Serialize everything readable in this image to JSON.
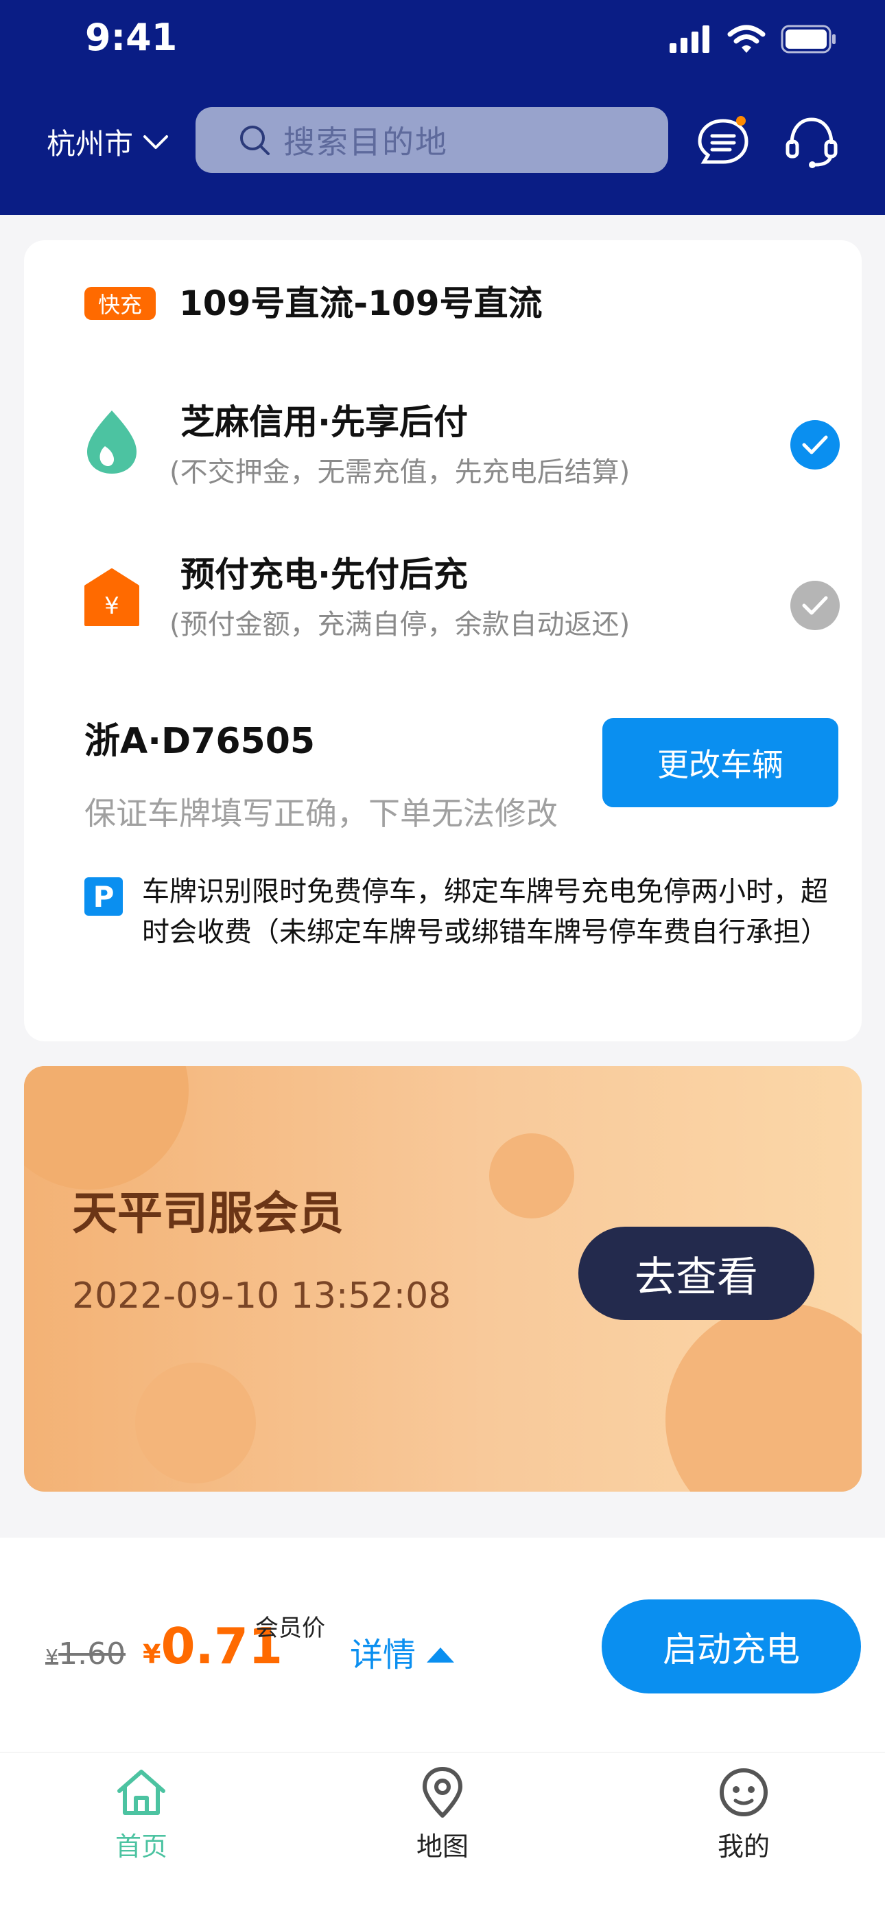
{
  "status_bar": {
    "time": "9:41"
  },
  "header": {
    "city": "杭州市",
    "search_placeholder": "搜索目的地",
    "icons": [
      "chevron-down-icon",
      "search-icon",
      "message-icon",
      "customer-service-icon"
    ],
    "colors": {
      "background": "#0a1d85",
      "notification_dot": "#ff8a00"
    }
  },
  "station": {
    "badge": "快充",
    "name": "109号直流-109号直流"
  },
  "payment_options": [
    {
      "title": "芝麻信用·先享后付",
      "desc": "(不交押金，无需充值，先充电后结算)",
      "selected": true,
      "icon": "sesame-credit-icon"
    },
    {
      "title": "预付充电·先付后充",
      "desc": "(预付金额，充满自停，余款自动返还)",
      "selected": false,
      "icon": "prepaid-yen-icon"
    }
  ],
  "vehicle": {
    "plate": "浙A·D76505",
    "hint": "保证车牌填写正确，下单无法修改",
    "change_button": "更改车辆"
  },
  "parking": {
    "icon_label": "P",
    "note": "车牌识别限时免费停车，绑定车牌号充电免停两小时，超时会收费（未绑定车牌号或绑错车牌号停车费自行承担）"
  },
  "membership": {
    "title": "天平司服会员",
    "date": "2022-09-10   13:52:08",
    "button": "去查看"
  },
  "price": {
    "original_yen": "¥",
    "original": "1.60",
    "current_yen": "¥",
    "current": "0.71",
    "member_label": "会员价",
    "detail": "详情",
    "start_button": "启动充电",
    "colors": {
      "price": "#ff6a00",
      "accent": "#0a8ff0"
    }
  },
  "tabs": [
    {
      "label": "首页",
      "active": true,
      "icon": "home-icon"
    },
    {
      "label": "地图",
      "active": false,
      "icon": "map-pin-icon"
    },
    {
      "label": "我的",
      "active": false,
      "icon": "profile-icon"
    }
  ]
}
